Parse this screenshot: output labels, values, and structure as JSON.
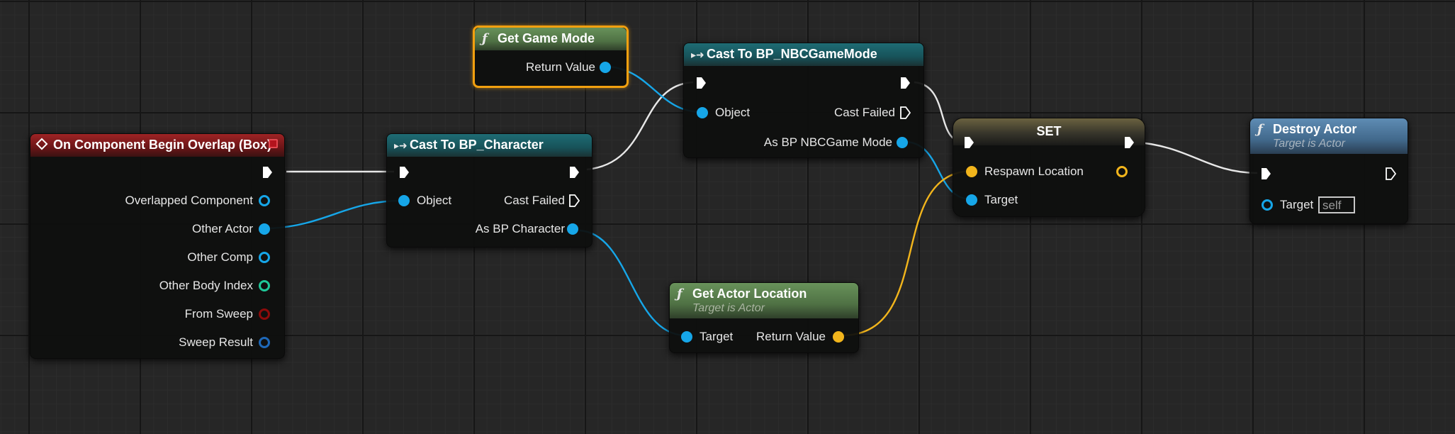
{
  "colors": {
    "wire_exec": "#e8e8e8",
    "wire_object": "#16a6e8",
    "wire_vector": "#f2b51c",
    "selection": "#f2a00f"
  },
  "nodes": {
    "overlap": {
      "title": "On Component Begin Overlap (Box)",
      "pins": [
        "Overlapped Component",
        "Other Actor",
        "Other Comp",
        "Other Body Index",
        "From Sweep",
        "Sweep Result"
      ]
    },
    "cast_character": {
      "title": "Cast To BP_Character",
      "object": "Object",
      "cast_failed": "Cast Failed",
      "as_output": "As BP Character"
    },
    "get_game_mode": {
      "title": "Get Game Mode",
      "return_value": "Return Value"
    },
    "cast_gamemode": {
      "title": "Cast To BP_NBCGameMode",
      "object": "Object",
      "cast_failed": "Cast Failed",
      "as_output": "As BP NBCGame Mode"
    },
    "get_actor_location": {
      "title": "Get Actor Location",
      "subtitle": "Target is Actor",
      "target": "Target",
      "return_value": "Return Value"
    },
    "set": {
      "title": "SET",
      "respawn": "Respawn Location",
      "target": "Target"
    },
    "destroy": {
      "title": "Destroy Actor",
      "subtitle": "Target is Actor",
      "target": "Target",
      "target_default": "self"
    }
  }
}
